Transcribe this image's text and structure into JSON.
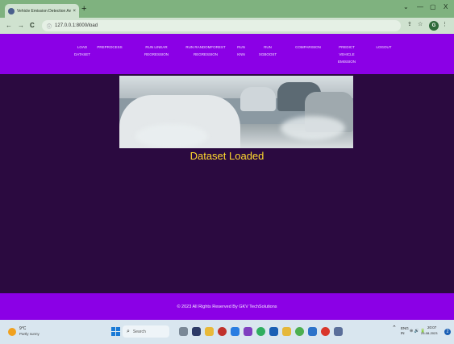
{
  "browser": {
    "tab_title": "Vehicle Emission Detection And",
    "tab_close": "×",
    "new_tab": "+",
    "window_controls": [
      "⌄",
      "—",
      "▢",
      "X"
    ],
    "nav_buttons": [
      "←",
      "→",
      "C"
    ],
    "info_icon": "ⓘ",
    "url": "127.0.0.1:8000/load",
    "addr_icons": [
      "⇪",
      "☆",
      "▣",
      "⋮"
    ],
    "profile_initial": "G"
  },
  "nav": {
    "items": [
      {
        "label": "LOAD\nDATASET"
      },
      {
        "label": "PREPROCESS"
      },
      {
        "label": "RUN LINEAR\nREGRESSION"
      },
      {
        "label": "RUN RANDOMFOREST\nREGRESSION"
      },
      {
        "label": "RUN\nKNN"
      },
      {
        "label": "RUN\nXGBOOST"
      },
      {
        "label": "COMPARISION"
      },
      {
        "label": "PREDICT\nVEHICLE\nEMISSION"
      },
      {
        "label": "LOGOUT"
      }
    ]
  },
  "main": {
    "message": "Dataset Loaded",
    "message_color": "#ffd92e"
  },
  "footer": {
    "text": "© 2023 All Rights Reserved By GKV TechSolutions"
  },
  "taskbar": {
    "weather_temp": "9°C",
    "weather_desc": "Partly sunny",
    "search_placeholder": "Search",
    "tray_lang": "ENG\nIN",
    "tray_icons": "⌃",
    "tray_status": "⊜ 🔊 🔋",
    "time": "20:07",
    "date": "25-08-2023",
    "notification_count": "2"
  },
  "colors": {
    "nav_bg": "#8b00e6",
    "page_bg": "#2b0a40",
    "tab_strip": "#7fb27f"
  }
}
